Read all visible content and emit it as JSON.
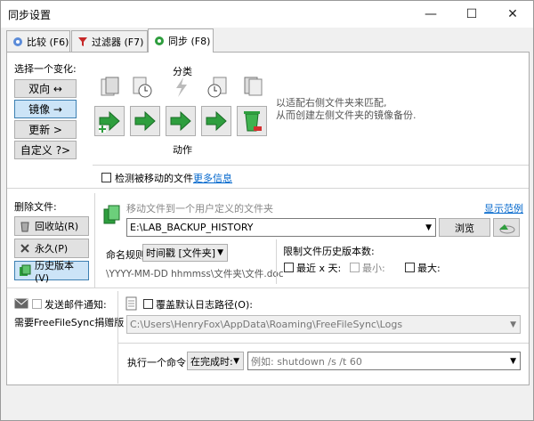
{
  "window": {
    "title": "同步设置",
    "minimize": "—",
    "maximize": "☐",
    "close": "✕"
  },
  "tabs": [
    {
      "label": "比较 (F6)",
      "icon": "gear-icon"
    },
    {
      "label": "过滤器 (F7)",
      "icon": "filter-icon"
    },
    {
      "label": "同步 (F8)",
      "icon": "gear-green-icon"
    }
  ],
  "variant": {
    "header": "选择一个变化:",
    "buttons": [
      "双向 ↔",
      "镜像 →",
      "更新 >",
      "自定义 ?>"
    ],
    "selected": 1
  },
  "categories_label": "分类",
  "actions_label": "动作",
  "description": "以适配右侧文件夹来匹配,\n从而创建左侧文件夹的镜像备份.",
  "detect_moved": {
    "label": "检测被移动的文件",
    "more": "更多信息"
  },
  "delete_files": {
    "header": "删除文件:",
    "options": [
      "回收站(R)",
      "永久(P)",
      "历史版本(V)"
    ],
    "selected": 2
  },
  "versioning": {
    "move_hint": "移动文件到一个用户定义的文件夹",
    "show_example": "显示范例",
    "path": "E:\\LAB_BACKUP_HISTORY",
    "browse": "浏览",
    "naming_label": "命名规则:",
    "naming_value": "时间戳 [文件夹]",
    "naming_example": "\\YYYY-MM-DD hhmmss\\文件夹\\文件.doc",
    "limit_header": "限制文件历史版本数:",
    "limit_last": "最近 x 天:",
    "limit_min": "最小:",
    "limit_max": "最大:"
  },
  "email": {
    "label": "发送邮件通知:",
    "requires": "需要FreeFileSync捐赠版"
  },
  "log": {
    "label": "覆盖默认日志路径(O):",
    "path": "C:\\Users\\HenryFox\\AppData\\Roaming\\FreeFileSync\\Logs"
  },
  "command": {
    "label": "执行一个命令:",
    "when": "在完成时:",
    "placeholder": "例如: shutdown /s /t 60"
  }
}
